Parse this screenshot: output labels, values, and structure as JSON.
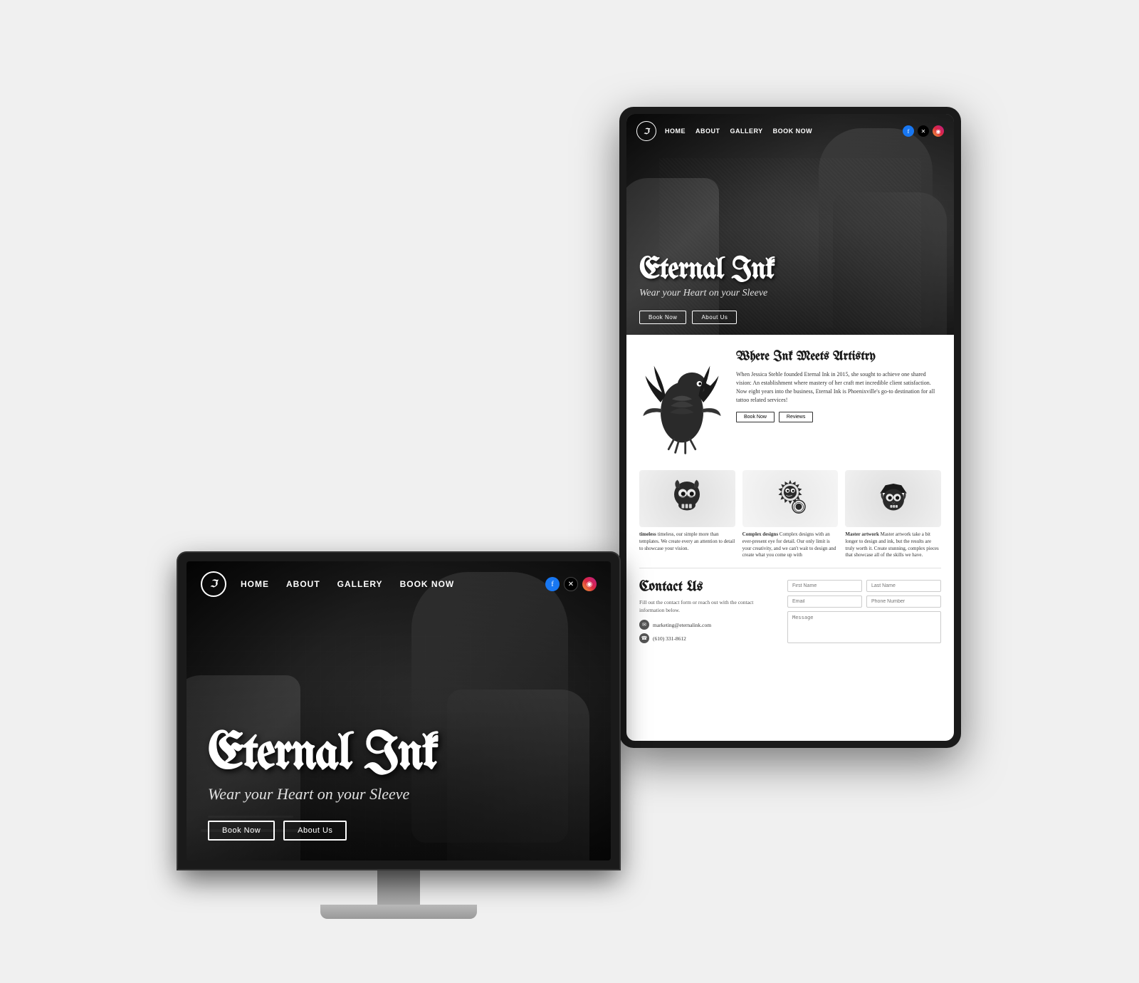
{
  "scene": {
    "background_color": "#f0eeec"
  },
  "monitor": {
    "nav": {
      "logo_text": "ℑ",
      "links": [
        "HOME",
        "ABOUT",
        "GALLERY",
        "BOOK NOW"
      ],
      "social": [
        "f",
        "𝕏",
        "📷"
      ]
    },
    "hero": {
      "title": "Eternal Ink",
      "subtitle": "Wear your Heart on your Sleeve",
      "btn_book": "Book Now",
      "btn_about": "About Us"
    }
  },
  "tablet": {
    "nav": {
      "logo_text": "ℑ",
      "links": [
        "HOME",
        "ABOUT",
        "GALLERY",
        "BOOK NOW"
      ]
    },
    "hero": {
      "title": "Eternal Ink",
      "subtitle": "Wear your Heart on your Sleeve",
      "btn_book": "Book Now",
      "btn_about": "About Us"
    },
    "about": {
      "section_title": "Where Ink Meets Artistry",
      "description": "When Jessica Stehle founded Eternal Ink in 2015, she sought to achieve one shared vision: An establishment where mastery of her craft met incredible client satisfaction. Now eight years into the business, Eternal Ink is Phoenixville's go-to destination for all tattoo related services!",
      "btn_book": "Book Now",
      "btn_reviews": "Reviews"
    },
    "designs": [
      {
        "title": "timeless",
        "description": "timeless, our simple more than templates. We create every an attention to detail to showcase your vision."
      },
      {
        "title": "Complex designs",
        "description": "Complex designs with an ever-present eye for detail. Our only limit is your creativity, and we can't wait to design and create what you come up with"
      },
      {
        "title": "Master artwork",
        "description": "Master artwork take a bit longer to design and ink, but the results are truly worth it. Create stunning, complex pieces that showcase all of the skills we have."
      }
    ],
    "contact": {
      "title": "Contact Us",
      "description": "Fill out the contact form or reach out with the contact information below.",
      "email": "marketing@eternalink.com",
      "phone": "(610) 331-8612",
      "form": {
        "first_name_placeholder": "First Name",
        "last_name_placeholder": "Last Name",
        "email_placeholder": "Email",
        "phone_placeholder": "Phone Number",
        "message_placeholder": "Message"
      }
    }
  }
}
